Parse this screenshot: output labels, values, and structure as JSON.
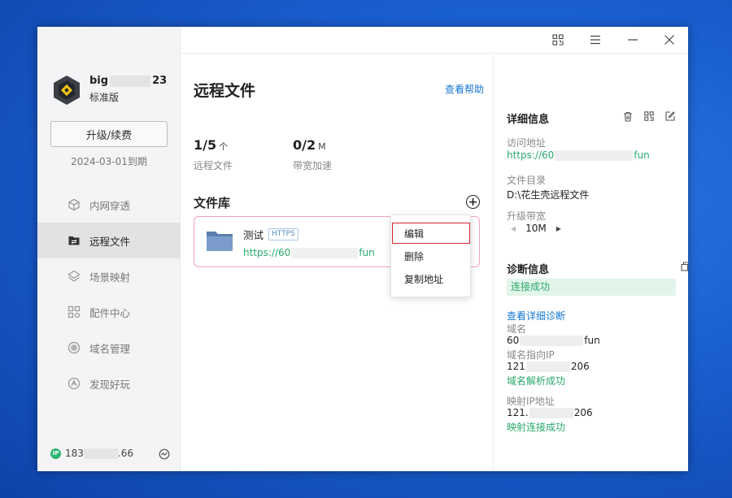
{
  "user": {
    "name_start": "big",
    "name_end": "23",
    "plan": "标准版",
    "upgrade_label": "升级/续费",
    "expire": "2024-03-01到期"
  },
  "nav": [
    {
      "label": "内网穿透",
      "icon": "cube-icon"
    },
    {
      "label": "远程文件",
      "icon": "folder-transfer-icon",
      "active": true
    },
    {
      "label": "场景映射",
      "icon": "scene-icon"
    },
    {
      "label": "配件中心",
      "icon": "grid-icon"
    },
    {
      "label": "域名管理",
      "icon": "domain-icon"
    },
    {
      "label": "发现好玩",
      "icon": "discover-icon"
    }
  ],
  "footer": {
    "ip_badge": "IP",
    "ip_start": "183",
    "ip_end": ".66"
  },
  "main": {
    "title": "远程文件",
    "help": "查看帮助",
    "stats": [
      {
        "value": "1/5",
        "unit": "个",
        "label": "远程文件"
      },
      {
        "value": "0/2",
        "unit": "M",
        "label": "带宽加速"
      }
    ],
    "library_title": "文件库",
    "file": {
      "name": "测试",
      "tag": "HTTPS",
      "url_start": "https://60",
      "url_end": "fun",
      "enabled": true
    }
  },
  "context_menu": {
    "items": [
      "编辑",
      "删除",
      "复制地址"
    ]
  },
  "details": {
    "title": "详细信息",
    "access_label": "访问地址",
    "access_start": "https://60",
    "access_end": "fun",
    "dir_label": "文件目录",
    "dir_value": "D:\\花生壳远程文件",
    "bw_label": "升级带宽",
    "bw_value": "10M"
  },
  "diagnosis": {
    "title": "诊断信息",
    "status": "连接成功",
    "detail_link": "查看详细诊断",
    "domain_label": "域名",
    "domain_start": "60",
    "domain_end": "fun",
    "domain_ip_label": "域名指向IP",
    "domain_ip_start": "121",
    "domain_ip_end": "206",
    "domain_resolve": "域名解析成功",
    "map_ip_label": "映射IP地址",
    "map_ip_start": "121.",
    "map_ip_end": "206",
    "map_status": "映射连接成功"
  },
  "colors": {
    "accent_green": "#2bb673",
    "link_blue": "#1677d2",
    "highlight_red": "#d3272e"
  }
}
